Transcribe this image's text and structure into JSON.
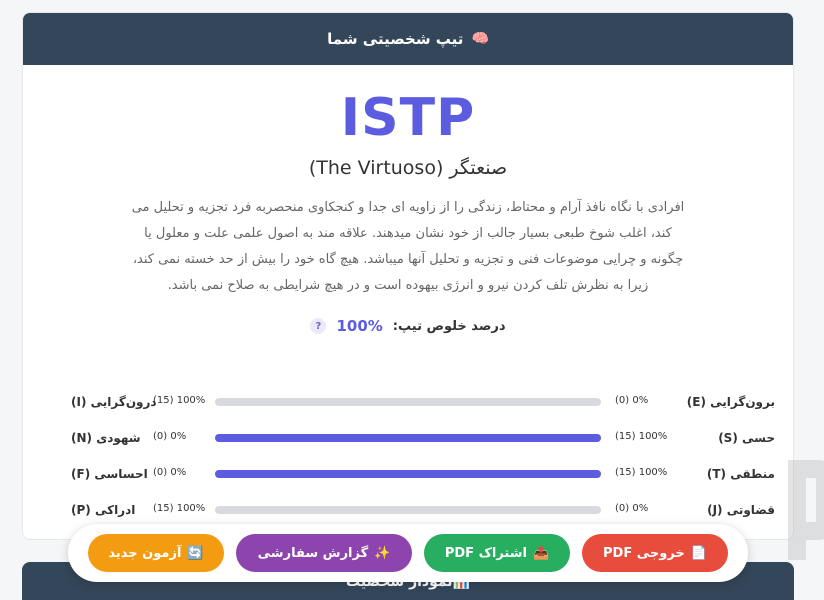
{
  "header": {
    "icon": "🧠",
    "title": "تیپ شخصیتی شما"
  },
  "result": {
    "code": "ISTP",
    "name": "صنعتگر (The Virtuoso)",
    "description": "افرادی با نگاه نافذ آرام و محتاط، زندگی را از زاویه ای جدا و کنجکاوی منحصربه فرد تجزیه و تحلیل می کند، اغلب شوخ طبعی بسیار جالب از خود نشان میدهند. علاقه مند به اصول علمی علت و معلول یا چگونه و چرایی موضوعات فنی و تجزیه و تحلیل آنها میباشد. هیچ گاه خود را بیش از حد خسته نمی کند، زیرا به نظرش تلف کردن نیرو و انرژی بیهوده است و در هیچ شرایطی به صلاح نمی باشد.",
    "purity_label": "درصد خلوص تیپ:",
    "purity_value": "100%",
    "help": "?"
  },
  "dimensions": [
    {
      "right_label": "برون‌گرایی (E)",
      "right_value": "(0) 0%",
      "left_value": "(15) 100%",
      "left_label": "درون‌گرایی (I)",
      "fill": 0
    },
    {
      "right_label": "حسی (S)",
      "right_value": "(15) 100%",
      "left_value": "(0) 0%",
      "left_label": "شهودی (N)",
      "fill": 1
    },
    {
      "right_label": "منطقی (T)",
      "right_value": "(15) 100%",
      "left_value": "(0) 0%",
      "left_label": "احساسی (F)",
      "fill": 1
    },
    {
      "right_label": "قضاوتی (J)",
      "right_value": "(0) 0%",
      "left_value": "(15) 100%",
      "left_label": "ادراکی (P)",
      "fill": 0
    }
  ],
  "section2": {
    "icon": "📊",
    "title": "نمودار شخصیت"
  },
  "actions": {
    "pdf": {
      "icon": "📄",
      "label": "خروجی PDF"
    },
    "share": {
      "icon": "📤",
      "label": "اشتراک PDF"
    },
    "custom": {
      "icon": "✨",
      "label": "گزارش سفارشی"
    },
    "new": {
      "icon": "🔄",
      "label": "آزمون جدید"
    }
  },
  "colors": {
    "accent": "#5b5ce0",
    "header": "#34465a",
    "pdf": "#e84c3d",
    "share": "#27ae60",
    "custom": "#8e44ad",
    "new": "#f39c12"
  }
}
